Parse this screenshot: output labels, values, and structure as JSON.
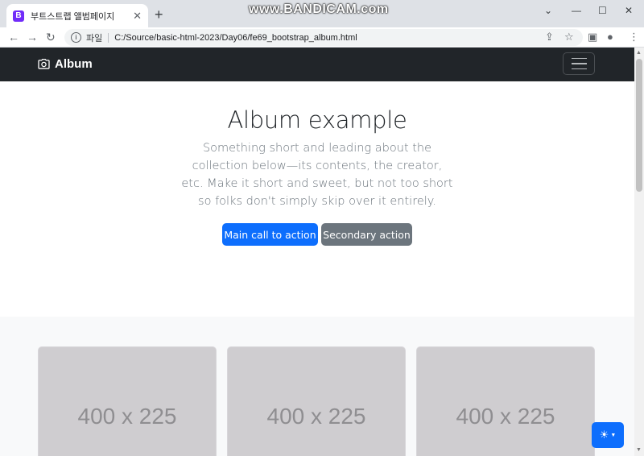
{
  "browser": {
    "tab_title": "부트스트랩 앨범페이지",
    "tab_favicon": "B",
    "new_tab": "+",
    "watermark": "www.BANDICAM.com",
    "address": {
      "scheme_label": "파일",
      "url": "C:/Source/basic-html-2023/Day06/fe69_bootstrap_album.html"
    },
    "icons": [
      "back-icon",
      "forward-icon",
      "reload-icon",
      "info-icon",
      "share-icon",
      "star-icon",
      "sidepanel-icon",
      "profile-icon",
      "menu-icon"
    ]
  },
  "navbar": {
    "brand": "Album",
    "brand_icon": "camera-icon"
  },
  "hero": {
    "title": "Album example",
    "lead": "Something short and leading about the collection below—its contents, the creator, etc. Make it short and sweet, but not too short so folks don't simply skip over it entirely.",
    "primary_button": "Main call to action",
    "secondary_button": "Secondary action"
  },
  "album": {
    "cards": [
      {
        "placeholder": "400 x 225"
      },
      {
        "placeholder": "400 x 225"
      },
      {
        "placeholder": "400 x 225"
      }
    ]
  },
  "theme_toggle": {
    "icon": "sun-icon"
  },
  "colors": {
    "navbar_bg": "#212529",
    "primary": "#0d6efd",
    "secondary": "#6c757d",
    "album_bg": "#f8f9fa",
    "placeholder_bg": "#cfcdd0"
  }
}
